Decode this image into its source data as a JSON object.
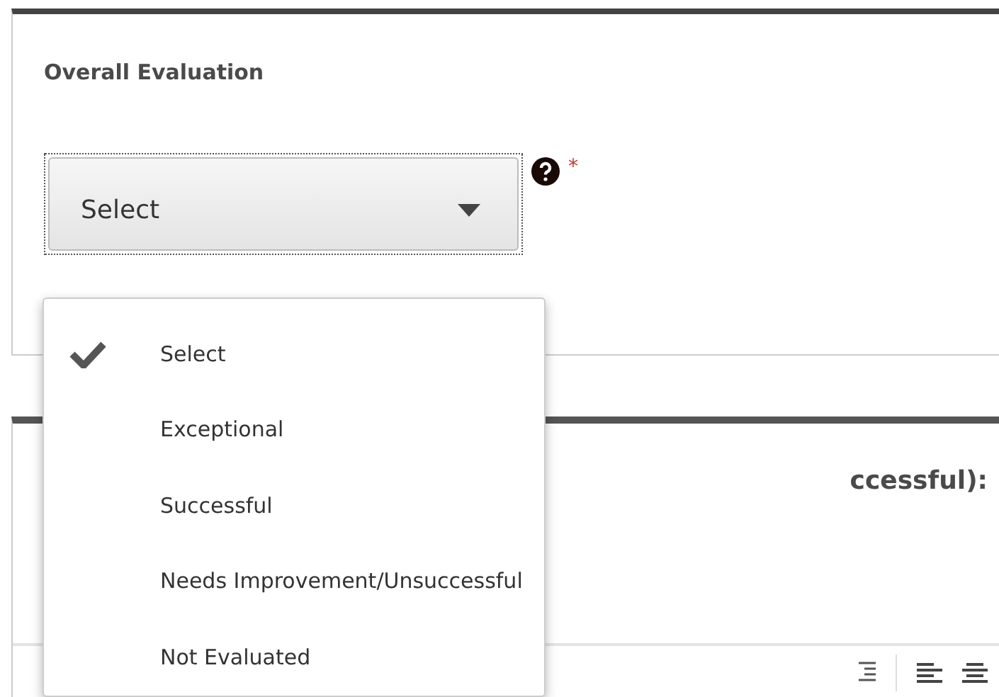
{
  "evaluation": {
    "heading": "Overall Evaluation",
    "select": {
      "value": "Select",
      "required_mark": "*"
    },
    "menu": [
      {
        "label": "Select",
        "selected": true
      },
      {
        "label": "Exceptional",
        "selected": false
      },
      {
        "label": "Successful",
        "selected": false
      },
      {
        "label": "Needs Improvement/Unsuccessful",
        "selected": false
      },
      {
        "label": "Not Evaluated",
        "selected": false
      }
    ]
  },
  "next_section": {
    "heading": "ccessful):"
  }
}
